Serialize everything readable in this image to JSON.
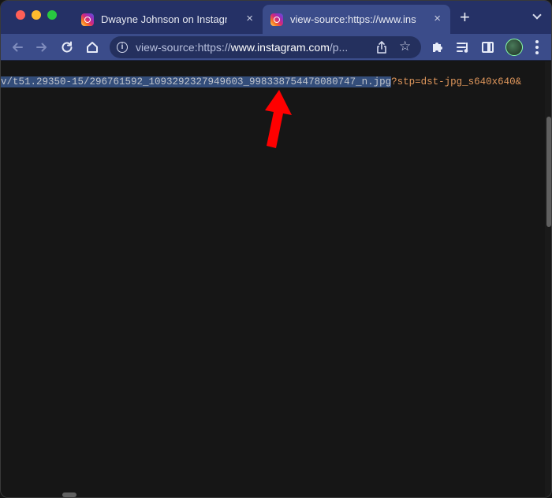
{
  "tabs": [
    {
      "title": "Dwayne Johnson on Instagram",
      "icon": "instagram-icon",
      "active": false
    },
    {
      "title": "view-source:https://www.instag",
      "icon": "instagram-icon",
      "active": true
    }
  ],
  "tab_close_glyph": "×",
  "new_tab_glyph": "+",
  "toolbar": {
    "url_prefix": "view-source:https://",
    "url_host": "www.instagram.com",
    "url_suffix": "/p..."
  },
  "source": {
    "selected_text": "v/t51.29350-15/296761592_1093292327949603_998338754478080747_n.jpg",
    "rest_text": "?stp=dst-jpg_s640x640&"
  },
  "annotation": {
    "arrow_color": "#ff0000"
  },
  "colors": {
    "tabstrip": "#253166",
    "toolbar": "#3b4c8a",
    "selection": "#334d7a",
    "source_text": "#e0975c"
  }
}
